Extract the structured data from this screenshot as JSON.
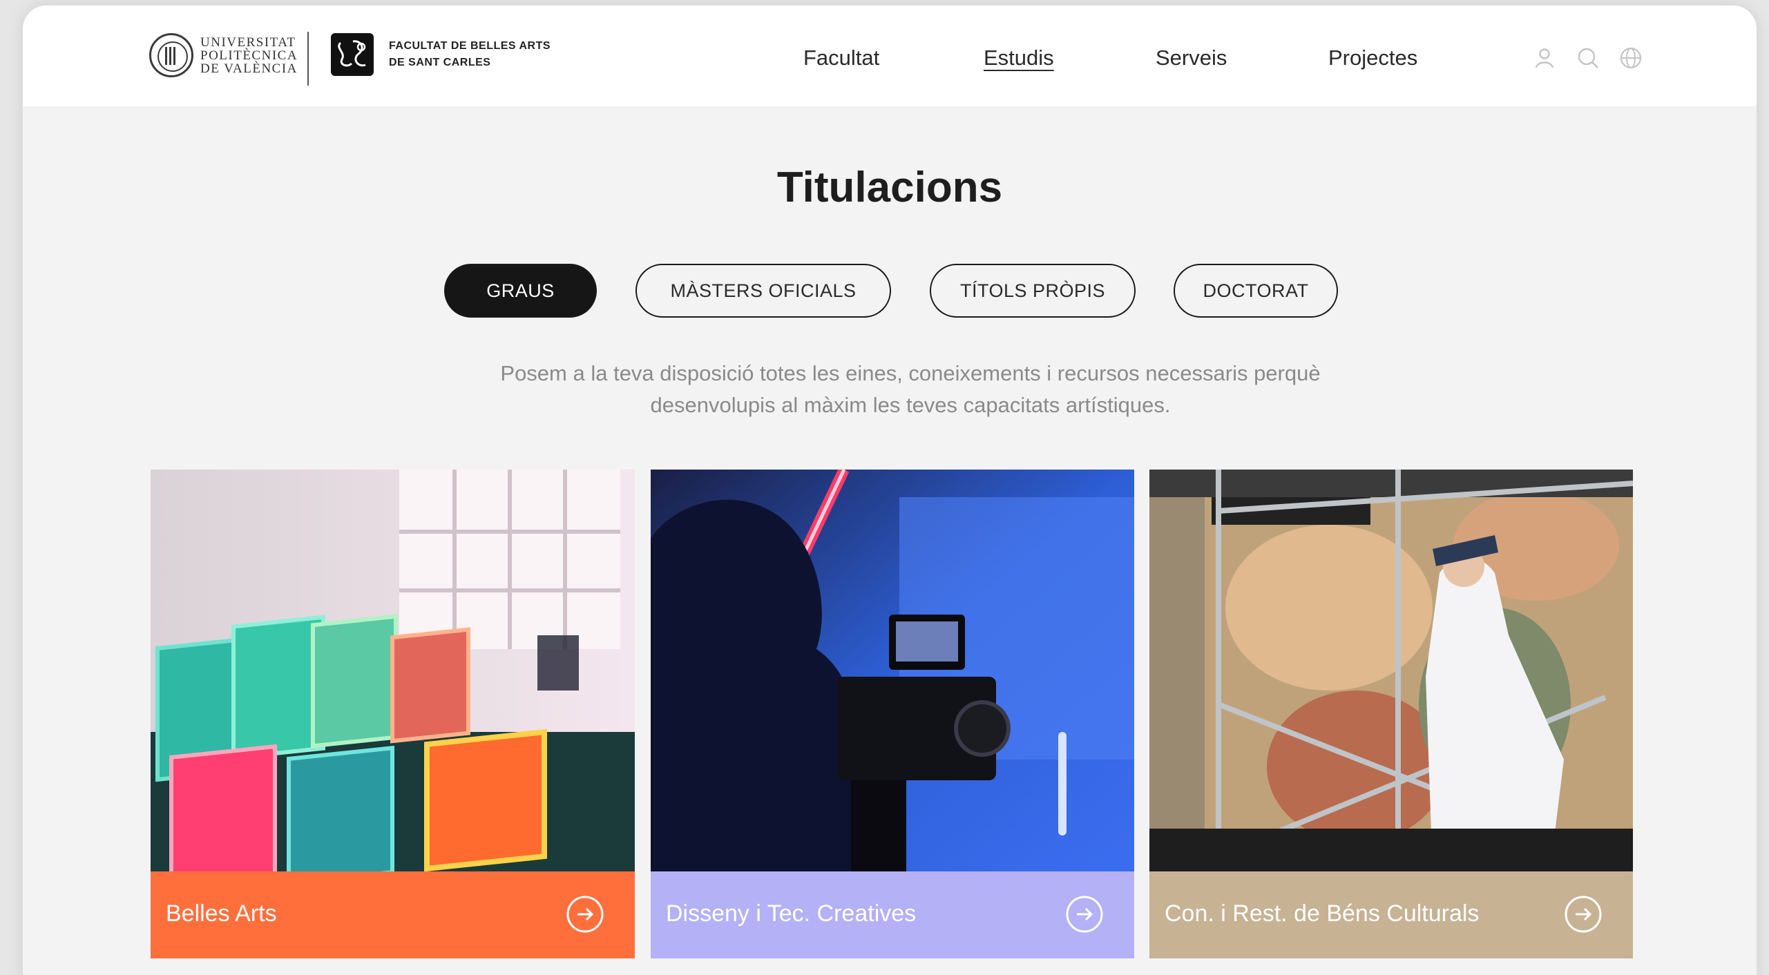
{
  "header": {
    "upv_logo_lines": [
      "UNIVERSITAT",
      "POLITÈCNICA",
      "DE VALÈNCIA"
    ],
    "faculty_logo_lines": [
      "FACULTAT DE BELLES ARTS",
      "DE SANT CARLES"
    ],
    "nav": [
      {
        "label": "Facultat",
        "active": false
      },
      {
        "label": "Estudis",
        "active": true
      },
      {
        "label": "Serveis",
        "active": false
      },
      {
        "label": "Projectes",
        "active": false
      }
    ],
    "icons": [
      "user-icon",
      "search-icon",
      "globe-icon"
    ]
  },
  "page": {
    "title": "Titulacions",
    "tabs": [
      {
        "label": "GRAUS",
        "active": true
      },
      {
        "label": "MÀSTERS OFICIALS",
        "active": false
      },
      {
        "label": "TÍTOLS PRÒPIS",
        "active": false
      },
      {
        "label": "DOCTORAT",
        "active": false
      }
    ],
    "intro_lines": [
      "Posem a la teva disposició totes les eines, coneixements i recursos necessaris perquè",
      "desenvolupis al màxim les teves capacitats artístiques."
    ]
  },
  "cards": [
    {
      "label": "Belles Arts",
      "color": "#ff6f3c"
    },
    {
      "label": "Disseny i Tec. Creatives",
      "color": "#b4b1f6"
    },
    {
      "label": "Con. i Rest. de Béns Culturals",
      "color": "#c8b294"
    }
  ],
  "colors": {
    "accent_dark": "#161616",
    "muted_text": "#8a8a8a"
  }
}
